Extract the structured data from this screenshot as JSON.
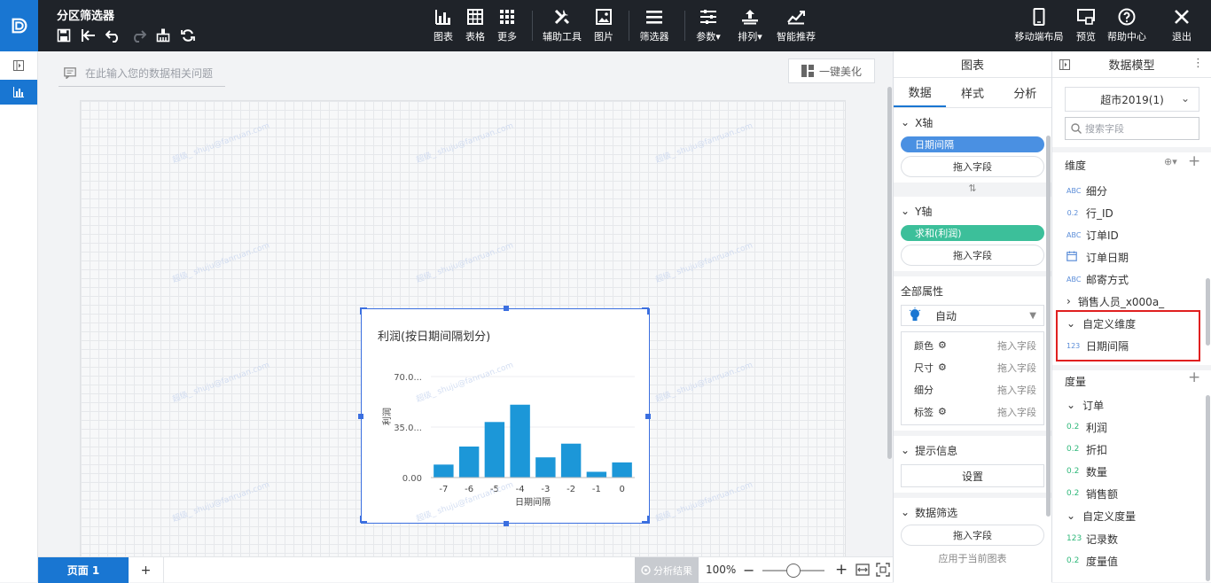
{
  "app": {
    "title": "分区筛选器"
  },
  "toolbar": {
    "chart": "图表",
    "table": "表格",
    "more": "更多",
    "aux_tools": "辅助工具",
    "image": "图片",
    "filter": "筛选器",
    "params": "参数",
    "arrange": "排列",
    "smart_rec": "智能推荐",
    "mobile_layout": "移动端布局",
    "preview": "预览",
    "help": "帮助中心",
    "exit": "退出"
  },
  "canvas": {
    "ask_placeholder": "在此输入您的数据相关问题",
    "beautify": "一键美化",
    "watermark": "超级_ shuju@fanruan.com"
  },
  "chart_data": {
    "type": "bar",
    "title": "利润(按日期间隔划分)",
    "xlabel": "日期间隔",
    "ylabel": "利润",
    "categories": [
      "-7",
      "-6",
      "-5",
      "-4",
      "-3",
      "-2",
      "-1",
      "0"
    ],
    "values": [
      9,
      21.5,
      38.5,
      50.5,
      14,
      23.5,
      4,
      10.5
    ],
    "y_ticks": [
      "0.00",
      "35.0...",
      "70.0..."
    ],
    "ylim": [
      0,
      70
    ],
    "bar_color": "#1c97d8",
    "grid": true
  },
  "bottom": {
    "page_tab": "页面 1",
    "add_page": "+",
    "analysis": "分析结果",
    "zoom": "100%"
  },
  "mid_panel": {
    "header": "图表",
    "tabs": [
      "数据",
      "样式",
      "分析"
    ],
    "x_axis": {
      "label": "X轴",
      "field": "日期间隔",
      "drop": "拖入字段"
    },
    "y_axis": {
      "label": "Y轴",
      "field": "求和(利润)",
      "drop": "拖入字段"
    },
    "global_props": {
      "label": "全部属性",
      "mode": "自动",
      "rows": [
        {
          "name": "颜色",
          "drop": "拖入字段"
        },
        {
          "name": "尺寸",
          "drop": "拖入字段"
        },
        {
          "name": "细分",
          "drop": "拖入字段"
        },
        {
          "name": "标签",
          "drop": "拖入字段"
        }
      ]
    },
    "tooltip": {
      "label": "提示信息",
      "button": "设置"
    },
    "data_filter": {
      "label": "数据筛选",
      "drop": "拖入字段",
      "footer": "应用于当前图表"
    }
  },
  "right_panel": {
    "header": "数据模型",
    "dataset": "超市2019(1)",
    "search_placeholder": "搜索字段",
    "dimension_label": "维度",
    "dimensions": [
      {
        "type": "ABC",
        "name": "细分"
      },
      {
        "type": "0.2",
        "name": "行_ID"
      },
      {
        "type": "ABC",
        "name": "订单ID"
      },
      {
        "type": "date",
        "name": "订单日期"
      },
      {
        "type": "ABC",
        "name": "邮寄方式"
      }
    ],
    "sales_group": "销售人员_x000a_",
    "custom_dim_group": "自定义维度",
    "custom_dim_item": {
      "type": "123",
      "name": "日期间隔"
    },
    "measure_label": "度量",
    "order_group": "订单",
    "measures": [
      {
        "type": "0.2",
        "name": "利润"
      },
      {
        "type": "0.2",
        "name": "折扣"
      },
      {
        "type": "0.2",
        "name": "数量"
      },
      {
        "type": "0.2",
        "name": "销售额"
      }
    ],
    "custom_measure_group": "自定义度量",
    "custom_measures": [
      {
        "type": "123",
        "name": "记录数"
      },
      {
        "type": "0.2",
        "name": "度量值"
      }
    ]
  }
}
